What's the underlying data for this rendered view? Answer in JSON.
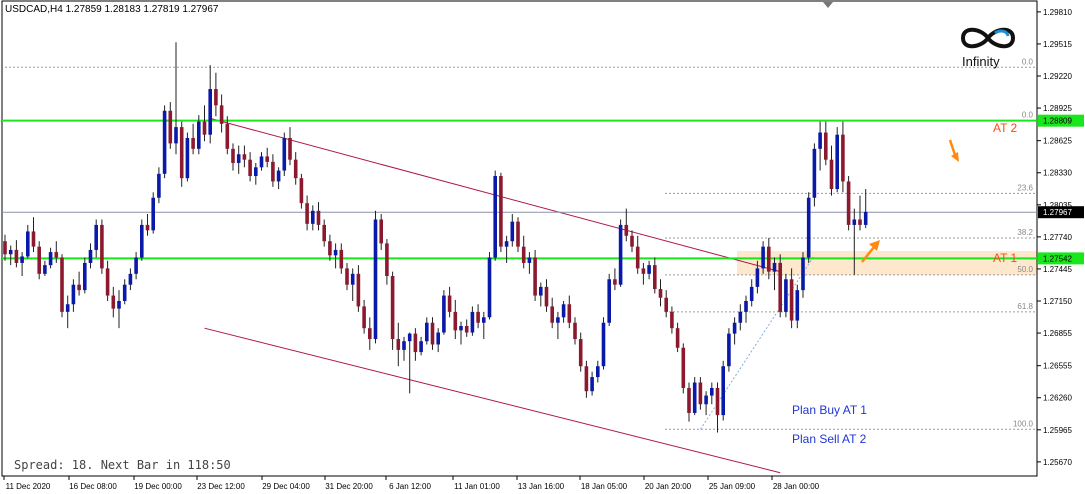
{
  "header": {
    "symbol_info": "USDCAD,H4  1.27859 1.28183 1.27819 1.27967"
  },
  "footer": {
    "spread_info": "Spread: 18. Next Bar in 118:50"
  },
  "logo": {
    "text": "Infinity"
  },
  "annotations": {
    "plan_buy": "Plan Buy AT 1",
    "plan_sell": "Plan Sell AT 2",
    "at2": "AT 2",
    "at1": "AT 1"
  },
  "colors": {
    "bull": "#0a1aa8",
    "bear": "#8b1a2f",
    "level_line": "#19e61b",
    "channel": "#b0154a",
    "zone": "#fde7cd",
    "arrow": "#ff8a10",
    "current_price": "#8a94a6",
    "fib": "#9a9a9a"
  },
  "chart_data": {
    "type": "candlestick",
    "symbol": "USDCAD",
    "timeframe": "H4",
    "ylim": [
      1.2554,
      1.2991
    ],
    "y_ticks": [
      "1.29810",
      "1.29515",
      "1.29220",
      "1.28925",
      "1.28625",
      "1.28330",
      "1.28035",
      "1.27740",
      "1.27445",
      "1.27150",
      "1.26855",
      "1.26555",
      "1.26260",
      "1.25965",
      "1.25670"
    ],
    "x_ticks": [
      "11 Dec 2020",
      "16 Dec 08:00",
      "19 Dec 00:00",
      "23 Dec 12:00",
      "29 Dec 04:00",
      "31 Dec 20:00",
      "6 Jan 12:00",
      "11 Jan 01:00",
      "13 Jan 16:00",
      "18 Jan 05:00",
      "20 Jan 20:00",
      "25 Jan 09:00",
      "28 Jan 00:00"
    ],
    "current_price": {
      "value": 1.27967,
      "label": "1.27967"
    },
    "levels": [
      {
        "name": "AT 2",
        "value": 1.28809,
        "label": "1.28809"
      },
      {
        "name": "AT 1",
        "value": 1.27542,
        "label": "1.27542"
      }
    ],
    "fibonacci": {
      "high": 1.2881,
      "low": 1.2597,
      "levels": [
        {
          "ratio": "0.0",
          "value": 1.2881
        },
        {
          "ratio": "23.6",
          "value": 1.2814
        },
        {
          "ratio": "38.2",
          "value": 1.2773
        },
        {
          "ratio": "50.0",
          "value": 1.2739
        },
        {
          "ratio": "61.8",
          "value": 1.2705
        },
        {
          "ratio": "100.0",
          "value": 1.2597
        }
      ],
      "extra_top": {
        "ratio": "0.0",
        "value": 1.293
      }
    },
    "zone": {
      "top": 1.2761,
      "bottom": 1.2739
    },
    "candles": [
      [
        1.277,
        1.2776,
        1.2752,
        1.2758
      ],
      [
        1.2758,
        1.2766,
        1.2748,
        1.2762
      ],
      [
        1.2762,
        1.2771,
        1.2746,
        1.275
      ],
      [
        1.275,
        1.276,
        1.2738,
        1.2756
      ],
      [
        1.2756,
        1.2785,
        1.2754,
        1.2779
      ],
      [
        1.2779,
        1.2792,
        1.276,
        1.2765
      ],
      [
        1.2765,
        1.277,
        1.2735,
        1.274
      ],
      [
        1.274,
        1.2752,
        1.2738,
        1.2748
      ],
      [
        1.2748,
        1.2764,
        1.2745,
        1.276
      ],
      [
        1.276,
        1.277,
        1.275,
        1.2755
      ],
      [
        1.2755,
        1.2758,
        1.27,
        1.2705
      ],
      [
        1.2705,
        1.272,
        1.269,
        1.2712
      ],
      [
        1.2712,
        1.2735,
        1.2705,
        1.273
      ],
      [
        1.273,
        1.2742,
        1.272,
        1.2725
      ],
      [
        1.2725,
        1.2755,
        1.2722,
        1.275
      ],
      [
        1.275,
        1.2768,
        1.2745,
        1.2762
      ],
      [
        1.2762,
        1.279,
        1.2755,
        1.2785
      ],
      [
        1.2785,
        1.279,
        1.274,
        1.2745
      ],
      [
        1.2745,
        1.2752,
        1.2715,
        1.272
      ],
      [
        1.272,
        1.2728,
        1.27,
        1.2708
      ],
      [
        1.2708,
        1.2725,
        1.269,
        1.2715
      ],
      [
        1.2715,
        1.2735,
        1.2712,
        1.273
      ],
      [
        1.273,
        1.2745,
        1.2725,
        1.274
      ],
      [
        1.274,
        1.276,
        1.2735,
        1.2755
      ],
      [
        1.2755,
        1.279,
        1.2752,
        1.2785
      ],
      [
        1.2785,
        1.2795,
        1.2775,
        1.278
      ],
      [
        1.278,
        1.2815,
        1.2777,
        1.281
      ],
      [
        1.281,
        1.2838,
        1.2805,
        1.2832
      ],
      [
        1.2832,
        1.2895,
        1.2828,
        1.289
      ],
      [
        1.289,
        1.2898,
        1.2855,
        1.286
      ],
      [
        1.286,
        1.2953,
        1.285,
        1.2875
      ],
      [
        1.2875,
        1.288,
        1.282,
        1.2828
      ],
      [
        1.2828,
        1.287,
        1.2825,
        1.2865
      ],
      [
        1.2865,
        1.2878,
        1.285,
        1.2855
      ],
      [
        1.2855,
        1.2886,
        1.285,
        1.288
      ],
      [
        1.288,
        1.2895,
        1.2862,
        1.2868
      ],
      [
        1.2868,
        1.2932,
        1.286,
        1.291
      ],
      [
        1.291,
        1.2925,
        1.2885,
        1.2895
      ],
      [
        1.2895,
        1.2905,
        1.287,
        1.2878
      ],
      [
        1.2878,
        1.2885,
        1.285,
        1.2855
      ],
      [
        1.2855,
        1.286,
        1.2835,
        1.2842
      ],
      [
        1.2842,
        1.2858,
        1.2832,
        1.285
      ],
      [
        1.285,
        1.2858,
        1.2838,
        1.2845
      ],
      [
        1.2845,
        1.2852,
        1.2825,
        1.283
      ],
      [
        1.283,
        1.2842,
        1.2822,
        1.2838
      ],
      [
        1.2838,
        1.2852,
        1.2835,
        1.2848
      ],
      [
        1.2848,
        1.2856,
        1.2838,
        1.2843
      ],
      [
        1.2843,
        1.285,
        1.282,
        1.2825
      ],
      [
        1.2825,
        1.2838,
        1.2818,
        1.2835
      ],
      [
        1.2835,
        1.287,
        1.283,
        1.2865
      ],
      [
        1.2865,
        1.2875,
        1.284,
        1.2845
      ],
      [
        1.2845,
        1.2852,
        1.2822,
        1.2828
      ],
      [
        1.2828,
        1.2832,
        1.28,
        1.2805
      ],
      [
        1.2805,
        1.2812,
        1.278,
        1.2786
      ],
      [
        1.2786,
        1.2803,
        1.278,
        1.2798
      ],
      [
        1.2798,
        1.2806,
        1.278,
        1.2785
      ],
      [
        1.2785,
        1.279,
        1.2765,
        1.277
      ],
      [
        1.277,
        1.2776,
        1.2752,
        1.2757
      ],
      [
        1.2757,
        1.2768,
        1.2745,
        1.2762
      ],
      [
        1.2762,
        1.2768,
        1.274,
        1.2745
      ],
      [
        1.2745,
        1.275,
        1.2725,
        1.273
      ],
      [
        1.273,
        1.2745,
        1.2715,
        1.274
      ],
      [
        1.274,
        1.2748,
        1.2705,
        1.271
      ],
      [
        1.271,
        1.2716,
        1.2685,
        1.269
      ],
      [
        1.269,
        1.27,
        1.267,
        1.268
      ],
      [
        1.268,
        1.2798,
        1.2676,
        1.279
      ],
      [
        1.279,
        1.2795,
        1.2762,
        1.2768
      ],
      [
        1.2768,
        1.2772,
        1.273,
        1.2738
      ],
      [
        1.2738,
        1.2742,
        1.267,
        1.268
      ],
      [
        1.268,
        1.2695,
        1.2655,
        1.267
      ],
      [
        1.267,
        1.2682,
        1.266,
        1.2678
      ],
      [
        1.2678,
        1.2686,
        1.263,
        1.2685
      ],
      [
        1.2685,
        1.269,
        1.266,
        1.2668
      ],
      [
        1.2668,
        1.2682,
        1.2665,
        1.2678
      ],
      [
        1.2678,
        1.27,
        1.2675,
        1.2695
      ],
      [
        1.2695,
        1.27,
        1.267,
        1.2675
      ],
      [
        1.2675,
        1.269,
        1.2668,
        1.2686
      ],
      [
        1.2686,
        1.2725,
        1.2684,
        1.272
      ],
      [
        1.272,
        1.2728,
        1.27,
        1.2705
      ],
      [
        1.2705,
        1.2716,
        1.268,
        1.2688
      ],
      [
        1.2688,
        1.2696,
        1.2675,
        1.2692
      ],
      [
        1.2692,
        1.2698,
        1.2682,
        1.2686
      ],
      [
        1.2686,
        1.271,
        1.2683,
        1.2705
      ],
      [
        1.2705,
        1.2712,
        1.269,
        1.2695
      ],
      [
        1.2695,
        1.2705,
        1.268,
        1.27
      ],
      [
        1.27,
        1.276,
        1.2698,
        1.2755
      ],
      [
        1.2755,
        1.2835,
        1.2752,
        1.283
      ],
      [
        1.283,
        1.2833,
        1.276,
        1.2765
      ],
      [
        1.2765,
        1.2775,
        1.275,
        1.277
      ],
      [
        1.277,
        1.2795,
        1.2765,
        1.2788
      ],
      [
        1.2788,
        1.2792,
        1.276,
        1.2765
      ],
      [
        1.2765,
        1.2775,
        1.2745,
        1.275
      ],
      [
        1.275,
        1.276,
        1.274,
        1.2755
      ],
      [
        1.2755,
        1.2762,
        1.2715,
        1.272
      ],
      [
        1.272,
        1.2732,
        1.271,
        1.2728
      ],
      [
        1.2728,
        1.2735,
        1.2705,
        1.271
      ],
      [
        1.271,
        1.2718,
        1.269,
        1.2695
      ],
      [
        1.2695,
        1.2705,
        1.268,
        1.27
      ],
      [
        1.27,
        1.2715,
        1.2695,
        1.2712
      ],
      [
        1.2712,
        1.272,
        1.269,
        1.2695
      ],
      [
        1.2695,
        1.27,
        1.2675,
        1.268
      ],
      [
        1.268,
        1.2686,
        1.265,
        1.2655
      ],
      [
        1.2655,
        1.266,
        1.2626,
        1.2632
      ],
      [
        1.2632,
        1.265,
        1.2628,
        1.2645
      ],
      [
        1.2645,
        1.266,
        1.264,
        1.2655
      ],
      [
        1.2655,
        1.27,
        1.2652,
        1.2695
      ],
      [
        1.2695,
        1.274,
        1.2692,
        1.2735
      ],
      [
        1.2735,
        1.2745,
        1.2725,
        1.273
      ],
      [
        1.273,
        1.279,
        1.2728,
        1.2785
      ],
      [
        1.2785,
        1.28,
        1.277,
        1.2775
      ],
      [
        1.2775,
        1.278,
        1.276,
        1.2765
      ],
      [
        1.2765,
        1.2775,
        1.274,
        1.2745
      ],
      [
        1.2745,
        1.275,
        1.273,
        1.274
      ],
      [
        1.274,
        1.2752,
        1.2735,
        1.2748
      ],
      [
        1.2748,
        1.2755,
        1.2722,
        1.2726
      ],
      [
        1.2726,
        1.2735,
        1.271,
        1.2718
      ],
      [
        1.2718,
        1.2725,
        1.27,
        1.2705
      ],
      [
        1.2705,
        1.271,
        1.2685,
        1.269
      ],
      [
        1.269,
        1.2695,
        1.2668,
        1.2672
      ],
      [
        1.2672,
        1.2676,
        1.263,
        1.2635
      ],
      [
        1.2635,
        1.264,
        1.2604,
        1.2612
      ],
      [
        1.2612,
        1.2645,
        1.261,
        1.264
      ],
      [
        1.264,
        1.2645,
        1.2615,
        1.262
      ],
      [
        1.262,
        1.2632,
        1.261,
        1.2628
      ],
      [
        1.2628,
        1.264,
        1.262,
        1.2635
      ],
      [
        1.2635,
        1.264,
        1.2594,
        1.261
      ],
      [
        1.261,
        1.266,
        1.2605,
        1.2655
      ],
      [
        1.2655,
        1.269,
        1.265,
        1.2685
      ],
      [
        1.2685,
        1.27,
        1.2675,
        1.2695
      ],
      [
        1.2695,
        1.2712,
        1.2688,
        1.2705
      ],
      [
        1.2705,
        1.272,
        1.2695,
        1.2715
      ],
      [
        1.2715,
        1.2735,
        1.271,
        1.2728
      ],
      [
        1.2728,
        1.2752,
        1.2722,
        1.2745
      ],
      [
        1.2745,
        1.277,
        1.274,
        1.2765
      ],
      [
        1.2765,
        1.2773,
        1.2735,
        1.2742
      ],
      [
        1.2742,
        1.2755,
        1.2725,
        1.275
      ],
      [
        1.275,
        1.2758,
        1.27,
        1.2705
      ],
      [
        1.2705,
        1.274,
        1.27,
        1.2735
      ],
      [
        1.2735,
        1.2745,
        1.269,
        1.2697
      ],
      [
        1.2697,
        1.273,
        1.269,
        1.2725
      ],
      [
        1.2725,
        1.276,
        1.2718,
        1.2755
      ],
      [
        1.2755,
        1.2815,
        1.275,
        1.281
      ],
      [
        1.281,
        1.286,
        1.2802,
        1.2855
      ],
      [
        1.2855,
        1.288,
        1.2835,
        1.287
      ],
      [
        1.287,
        1.288,
        1.284,
        1.2845
      ],
      [
        1.2845,
        1.2858,
        1.2812,
        1.2818
      ],
      [
        1.2818,
        1.2875,
        1.2815,
        1.2868
      ],
      [
        1.2868,
        1.288,
        1.2815,
        1.2825
      ],
      [
        1.2825,
        1.283,
        1.278,
        1.2785
      ],
      [
        1.2785,
        1.28,
        1.2739,
        1.279
      ],
      [
        1.279,
        1.2812,
        1.278,
        1.2785
      ],
      [
        1.2785,
        1.2818,
        1.2782,
        1.2797
      ]
    ],
    "channel_lines": [
      {
        "from": [
          36,
          1.2883
        ],
        "to": [
          136,
          1.2742
        ]
      },
      {
        "from": [
          35,
          1.269
        ],
        "to": [
          136,
          1.2557
        ]
      }
    ],
    "trend_line": {
      "from": [
        122,
        1.2597
      ],
      "to": [
        142,
        1.2757
      ]
    }
  }
}
